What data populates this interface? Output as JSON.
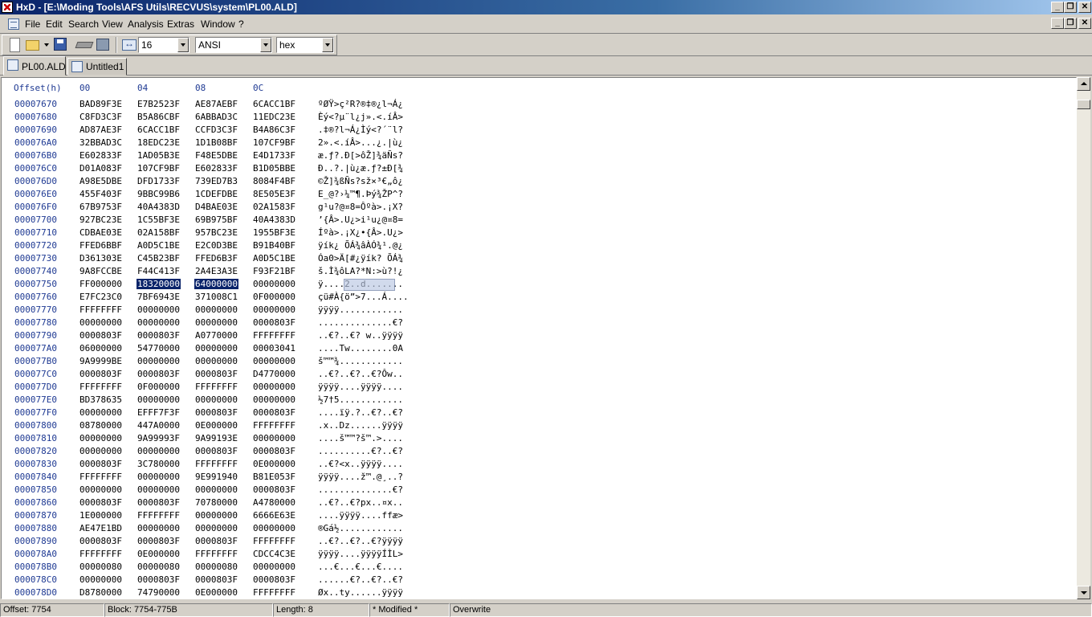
{
  "window": {
    "title": "HxD - [E:\\Moding Tools\\AFS Utils\\RECVUS\\system\\PL00.ALD]"
  },
  "menu": [
    "File",
    "Edit",
    "Search",
    "View",
    "Analysis",
    "Extras",
    "Window",
    "?"
  ],
  "toolbar": {
    "bytes_per_row": "16",
    "charset": "ANSI",
    "offset_base": "hex"
  },
  "tabs": [
    {
      "label": "PL00.ALD",
      "active": true
    },
    {
      "label": "Untitled1",
      "active": false
    }
  ],
  "editor": {
    "header": {
      "offset": "Offset(h)",
      "cols": [
        "00",
        "04",
        "08",
        "0C"
      ]
    },
    "rows": [
      {
        "offset": "00007670",
        "groups": [
          "BAD89F3E",
          "E7B2523F",
          "AE87AEBF",
          "6CACC1BF"
        ],
        "text": "ºØŸ>ç²R?®‡®¿l¬Á¿"
      },
      {
        "offset": "00007680",
        "groups": [
          "C8FD3C3F",
          "B5A86CBF",
          "6ABBAD3C",
          "11EDC23E"
        ],
        "text": "Èý<?µ¨l¿j».<.íÂ>"
      },
      {
        "offset": "00007690",
        "groups": [
          "AD87AE3F",
          "6CACC1BF",
          "CCFD3C3F",
          "B4A86C3F"
        ],
        "text": ".‡®?l¬Á¿Ìý<?´¨l?"
      },
      {
        "offset": "000076A0",
        "groups": [
          "32BBAD3C",
          "18EDC23E",
          "1D1B08BF",
          "107CF9BF"
        ],
        "text": "2».<.íÂ>...¿.|ù¿"
      },
      {
        "offset": "000076B0",
        "groups": [
          "E602833F",
          "1AD05B3E",
          "F48E5DBE",
          "E4D1733F"
        ],
        "text": "æ.ƒ?.Ð[>ôŽ]¾äÑs?"
      },
      {
        "offset": "000076C0",
        "groups": [
          "D01A083F",
          "107CF9BF",
          "E602833F",
          "B1D05BBE"
        ],
        "text": "Ð..?.|ù¿æ.ƒ?±Ð[¾"
      },
      {
        "offset": "000076D0",
        "groups": [
          "A98E5DBE",
          "DFD1733F",
          "739ED7B3",
          "8084F4BF"
        ],
        "text": "©Ž]¾ßÑs?sž×³€„ô¿"
      },
      {
        "offset": "000076E0",
        "groups": [
          "455F403F",
          "9BBC99B6",
          "1CDEFDBE",
          "8E505E3F"
        ],
        "text": "E_@?›¼™¶.Þý¾ŽP^?"
      },
      {
        "offset": "000076F0",
        "groups": [
          "67B9753F",
          "40A4383D",
          "D4BAE03E",
          "02A1583F"
        ],
        "text": "g¹u?@¤8=Ôºà>.¡X?"
      },
      {
        "offset": "00007700",
        "groups": [
          "927BC23E",
          "1C55BF3E",
          "69B975BF",
          "40A4383D"
        ],
        "text": "’{Â>.U¿>i¹u¿@¤8="
      },
      {
        "offset": "00007710",
        "groups": [
          "CDBAE03E",
          "02A158BF",
          "957BC23E",
          "1955BF3E"
        ],
        "text": "Íºà>.¡X¿•{Â>.U¿>"
      },
      {
        "offset": "00007720",
        "groups": [
          "FFED6BBF",
          "A0D5C1BE",
          "E2C0D3BE",
          "B91B40BF"
        ],
        "text": "ÿík¿ ÕÁ¾âÀÓ¾¹.@¿"
      },
      {
        "offset": "00007730",
        "groups": [
          "D361303E",
          "C45B23BF",
          "FFED6B3F",
          "A0D5C1BE"
        ],
        "text": "Óa0>Ä[#¿ÿík? ÕÁ¾"
      },
      {
        "offset": "00007740",
        "groups": [
          "9A8FCCBE",
          "F44C413F",
          "2A4E3A3E",
          "F93F21BF"
        ],
        "text": "š.Ì¾ôLA?*N:>ù?!¿"
      },
      {
        "offset": "00007750",
        "groups": [
          "FF000000",
          "18320000",
          "64000000",
          "00000000"
        ],
        "text": "ÿ....2..d.......",
        "selected": [
          1,
          2
        ]
      },
      {
        "offset": "00007760",
        "groups": [
          "E7FC23C0",
          "7BF6943E",
          "371008C1",
          "0F000000"
        ],
        "text": "çü#À{ö”>7...Á...."
      },
      {
        "offset": "00007770",
        "groups": [
          "FFFFFFFF",
          "00000000",
          "00000000",
          "00000000"
        ],
        "text": "ÿÿÿÿ............"
      },
      {
        "offset": "00007780",
        "groups": [
          "00000000",
          "00000000",
          "00000000",
          "0000803F"
        ],
        "text": "..............€?"
      },
      {
        "offset": "00007790",
        "groups": [
          "0000803F",
          "0000803F",
          "A0770000",
          "FFFFFFFF"
        ],
        "text": "..€?..€? w..ÿÿÿÿ"
      },
      {
        "offset": "000077A0",
        "groups": [
          "06000000",
          "54770000",
          "00000000",
          "00003041"
        ],
        "text": "....Tw........0A"
      },
      {
        "offset": "000077B0",
        "groups": [
          "9A9999BE",
          "00000000",
          "00000000",
          "00000000"
        ],
        "text": "š™™¾............"
      },
      {
        "offset": "000077C0",
        "groups": [
          "0000803F",
          "0000803F",
          "0000803F",
          "D4770000"
        ],
        "text": "..€?..€?..€?Ôw.."
      },
      {
        "offset": "000077D0",
        "groups": [
          "FFFFFFFF",
          "0F000000",
          "FFFFFFFF",
          "00000000"
        ],
        "text": "ÿÿÿÿ....ÿÿÿÿ...."
      },
      {
        "offset": "000077E0",
        "groups": [
          "BD378635",
          "00000000",
          "00000000",
          "00000000"
        ],
        "text": "½7†5............"
      },
      {
        "offset": "000077F0",
        "groups": [
          "00000000",
          "EFFF7F3F",
          "0000803F",
          "0000803F"
        ],
        "text": "....ïÿ.?..€?..€?"
      },
      {
        "offset": "00007800",
        "groups": [
          "08780000",
          "447A0000",
          "0E000000",
          "FFFFFFFF"
        ],
        "text": ".x..Dz......ÿÿÿÿ"
      },
      {
        "offset": "00007810",
        "groups": [
          "00000000",
          "9A99993F",
          "9A99193E",
          "00000000"
        ],
        "text": "....š™™?š™.>...."
      },
      {
        "offset": "00007820",
        "groups": [
          "00000000",
          "00000000",
          "0000803F",
          "0000803F"
        ],
        "text": "..........€?..€?"
      },
      {
        "offset": "00007830",
        "groups": [
          "0000803F",
          "3C780000",
          "FFFFFFFF",
          "0E000000"
        ],
        "text": "..€?<x..ÿÿÿÿ...."
      },
      {
        "offset": "00007840",
        "groups": [
          "FFFFFFFF",
          "00000000",
          "9E991940",
          "B81E053F"
        ],
        "text": "ÿÿÿÿ....ž™.@¸..?"
      },
      {
        "offset": "00007850",
        "groups": [
          "00000000",
          "00000000",
          "00000000",
          "0000803F"
        ],
        "text": "..............€?"
      },
      {
        "offset": "00007860",
        "groups": [
          "0000803F",
          "0000803F",
          "70780000",
          "A4780000"
        ],
        "text": "..€?..€?px..¤x.."
      },
      {
        "offset": "00007870",
        "groups": [
          "1E000000",
          "FFFFFFFF",
          "00000000",
          "6666E63E"
        ],
        "text": "....ÿÿÿÿ....ffæ>"
      },
      {
        "offset": "00007880",
        "groups": [
          "AE47E1BD",
          "00000000",
          "00000000",
          "00000000"
        ],
        "text": "®Gá½............"
      },
      {
        "offset": "00007890",
        "groups": [
          "0000803F",
          "0000803F",
          "0000803F",
          "FFFFFFFF"
        ],
        "text": "..€?..€?..€?ÿÿÿÿ"
      },
      {
        "offset": "000078A0",
        "groups": [
          "FFFFFFFF",
          "0E000000",
          "FFFFFFFF",
          "CDCC4C3E"
        ],
        "text": "ÿÿÿÿ....ÿÿÿÿÍÌL>"
      },
      {
        "offset": "000078B0",
        "groups": [
          "00000080",
          "00000080",
          "00000080",
          "00000000"
        ],
        "text": "...€...€...€...."
      },
      {
        "offset": "000078C0",
        "groups": [
          "00000000",
          "0000803F",
          "0000803F",
          "0000803F"
        ],
        "text": "......€?..€?..€?"
      },
      {
        "offset": "000078D0",
        "groups": [
          "D8780000",
          "74790000",
          "0E000000",
          "FFFFFFFF"
        ],
        "text": "Øx..ty......ÿÿÿÿ"
      }
    ]
  },
  "status": {
    "offset": "Offset: 7754",
    "block": "Block: 7754-775B",
    "length": "Length: 8",
    "modified": "* Modified *",
    "mode": "Overwrite"
  }
}
